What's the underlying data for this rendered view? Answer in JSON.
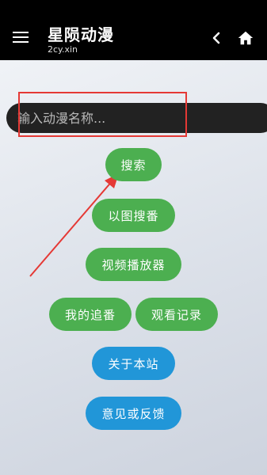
{
  "header": {
    "title": "星陨动漫",
    "subtitle": "2cy.xin"
  },
  "search": {
    "placeholder": "输入动漫名称..."
  },
  "buttons": {
    "search": "搜索",
    "image_search": "以图搜番",
    "video_player": "视频播放器",
    "my_follows": "我的追番",
    "history": "观看记录",
    "about": "关于本站",
    "feedback": "意见或反馈"
  },
  "colors": {
    "topbar": "#000000",
    "green_button": "#4caf50",
    "blue_button": "#2196d8",
    "annotation": "#e53935"
  },
  "icons": [
    "menu-icon",
    "chevron-left-icon",
    "home-icon"
  ]
}
